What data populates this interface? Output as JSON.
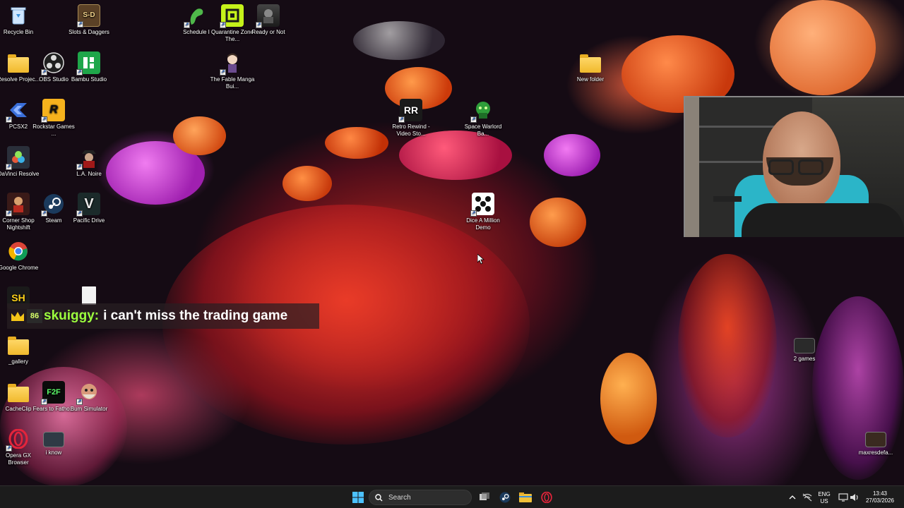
{
  "desktop_icons": [
    {
      "id": "recycle-bin",
      "label": "Recycle Bin"
    },
    {
      "id": "slots-daggers",
      "label": "Slots & Daggers"
    },
    {
      "id": "schedule-i",
      "label": "Schedule I"
    },
    {
      "id": "quarantine-zone",
      "label": "Quarantine Zone The..."
    },
    {
      "id": "ready-or-not",
      "label": "Ready or Not"
    },
    {
      "id": "resolve-projects",
      "label": "Resolve Projec..."
    },
    {
      "id": "obs-studio",
      "label": "OBS Studio"
    },
    {
      "id": "bambu-studio",
      "label": "Bambu Studio"
    },
    {
      "id": "fable-manga",
      "label": "The Fable Manga Bui..."
    },
    {
      "id": "new-folder",
      "label": "New folder"
    },
    {
      "id": "pcsx2",
      "label": "PCSX2"
    },
    {
      "id": "rockstar",
      "label": "Rockstar Games ..."
    },
    {
      "id": "retro-rewind",
      "label": "Retro Rewind - Video Sto..."
    },
    {
      "id": "space-warlord",
      "label": "Space Warlord Ba..."
    },
    {
      "id": "davinci",
      "label": "DaVinci Resolve"
    },
    {
      "id": "la-noire",
      "label": "L.A. Noire"
    },
    {
      "id": "corner-shop",
      "label": "Corner Shop Nightshift"
    },
    {
      "id": "steam",
      "label": "Steam"
    },
    {
      "id": "pacific-drive",
      "label": "Pacific Drive"
    },
    {
      "id": "dice-a-million",
      "label": "Dice A Million Demo"
    },
    {
      "id": "chrome",
      "label": "Google Chrome"
    },
    {
      "id": "gallery",
      "label": "_gallery"
    },
    {
      "id": "two-games",
      "label": "2 games"
    },
    {
      "id": "cacheclip",
      "label": "CacheClip"
    },
    {
      "id": "fears-to-fathom",
      "label": "Fears to Fatho..."
    },
    {
      "id": "bum-simulator",
      "label": "Bum Simulator"
    },
    {
      "id": "opera-gx",
      "label": "Opera GX Browser"
    },
    {
      "id": "i-know",
      "label": "i know"
    },
    {
      "id": "maxresdefault",
      "label": "maxresdefa..."
    }
  ],
  "icon_glyphs": {
    "slots-daggers": "S-D",
    "retro-rewind": "RR",
    "rockstar": "R",
    "pacific-drive": "V",
    "fears-to-fathom": "F2F",
    "corner-sh": "SH"
  },
  "chat": {
    "badge_sub": "86",
    "username": "skuiggy:",
    "message": "i can't miss the trading game",
    "username_color": "#9cff3e"
  },
  "taskbar": {
    "search_placeholder": "Search",
    "language": "ENG",
    "region": "US",
    "time": "13:43",
    "date": "27/03/2026"
  },
  "colors": {
    "taskbar_bg": "#1c1c1c",
    "accent_blue": "#1a73e8"
  }
}
